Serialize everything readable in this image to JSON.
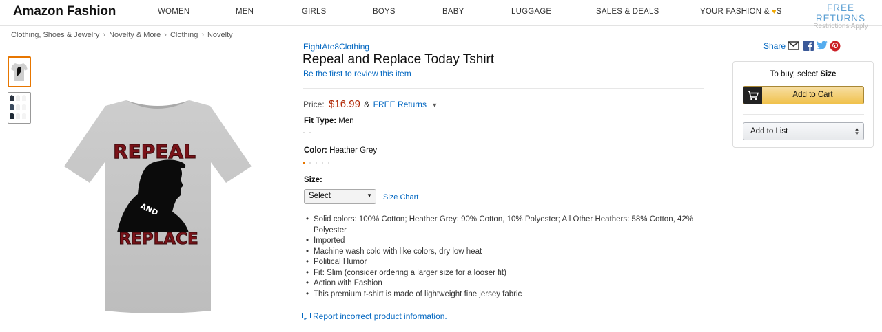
{
  "brand": "Amazon Fashion",
  "nav": {
    "items": [
      "WOMEN",
      "MEN",
      "GIRLS",
      "BOYS",
      "BABY",
      "LUGGAGE",
      "SALES & DEALS"
    ],
    "your_fashion_prefix": "YOUR FASHION &",
    "your_fashion_suffix": "S",
    "heart_icon": "heart-icon"
  },
  "free_returns": {
    "title": "FREE RETURNS",
    "subtitle": "Restrictions Apply"
  },
  "breadcrumb": [
    "Clothing, Shoes & Jewelry",
    "Novelty & More",
    "Clothing",
    "Novelty"
  ],
  "product": {
    "byline": "EightAte8Clothing",
    "title": "Repeal and Replace Today Tshirt",
    "review_link": "Be the first to review this item",
    "price_label": "Price:",
    "price": "$16.99",
    "amp": "&",
    "free_returns_link": "FREE Returns",
    "fit_type_label": "Fit Type:",
    "fit_type_value": "Men",
    "color_label": "Color:",
    "color_value": "Heather Grey",
    "size_label": "Size:",
    "size_select_value": "Select",
    "size_chart_link": "Size Chart",
    "shirt_text_top": "REPEAL",
    "shirt_text_mid": "AND",
    "shirt_text_bottom": "REPLACE",
    "bullets": [
      "Solid colors: 100% Cotton; Heather Grey: 90% Cotton, 10% Polyester; All Other Heathers: 58% Cotton, 42% Polyester",
      "Imported",
      "Machine wash cold with like colors, dry low heat",
      "Political Humor",
      "Fit: Slim (consider ordering a larger size for a looser fit)",
      "Action with Fashion",
      "This premium t-shirt is made of lightweight fine jersey fabric"
    ],
    "report_link": "Report incorrect product information."
  },
  "share": {
    "label": "Share",
    "icons": [
      "email-icon",
      "facebook-icon",
      "twitter-icon",
      "pinterest-icon"
    ]
  },
  "buybox": {
    "hint_prefix": "To buy, select",
    "hint_bold": "Size",
    "add_to_cart": "Add to Cart",
    "add_to_list": "Add to List"
  },
  "colors": {
    "link": "#0066c0",
    "price": "#b12704",
    "cart_button": "#f0c14b",
    "shirt": "#c8c8c8",
    "shirt_text": "#7a1218"
  }
}
